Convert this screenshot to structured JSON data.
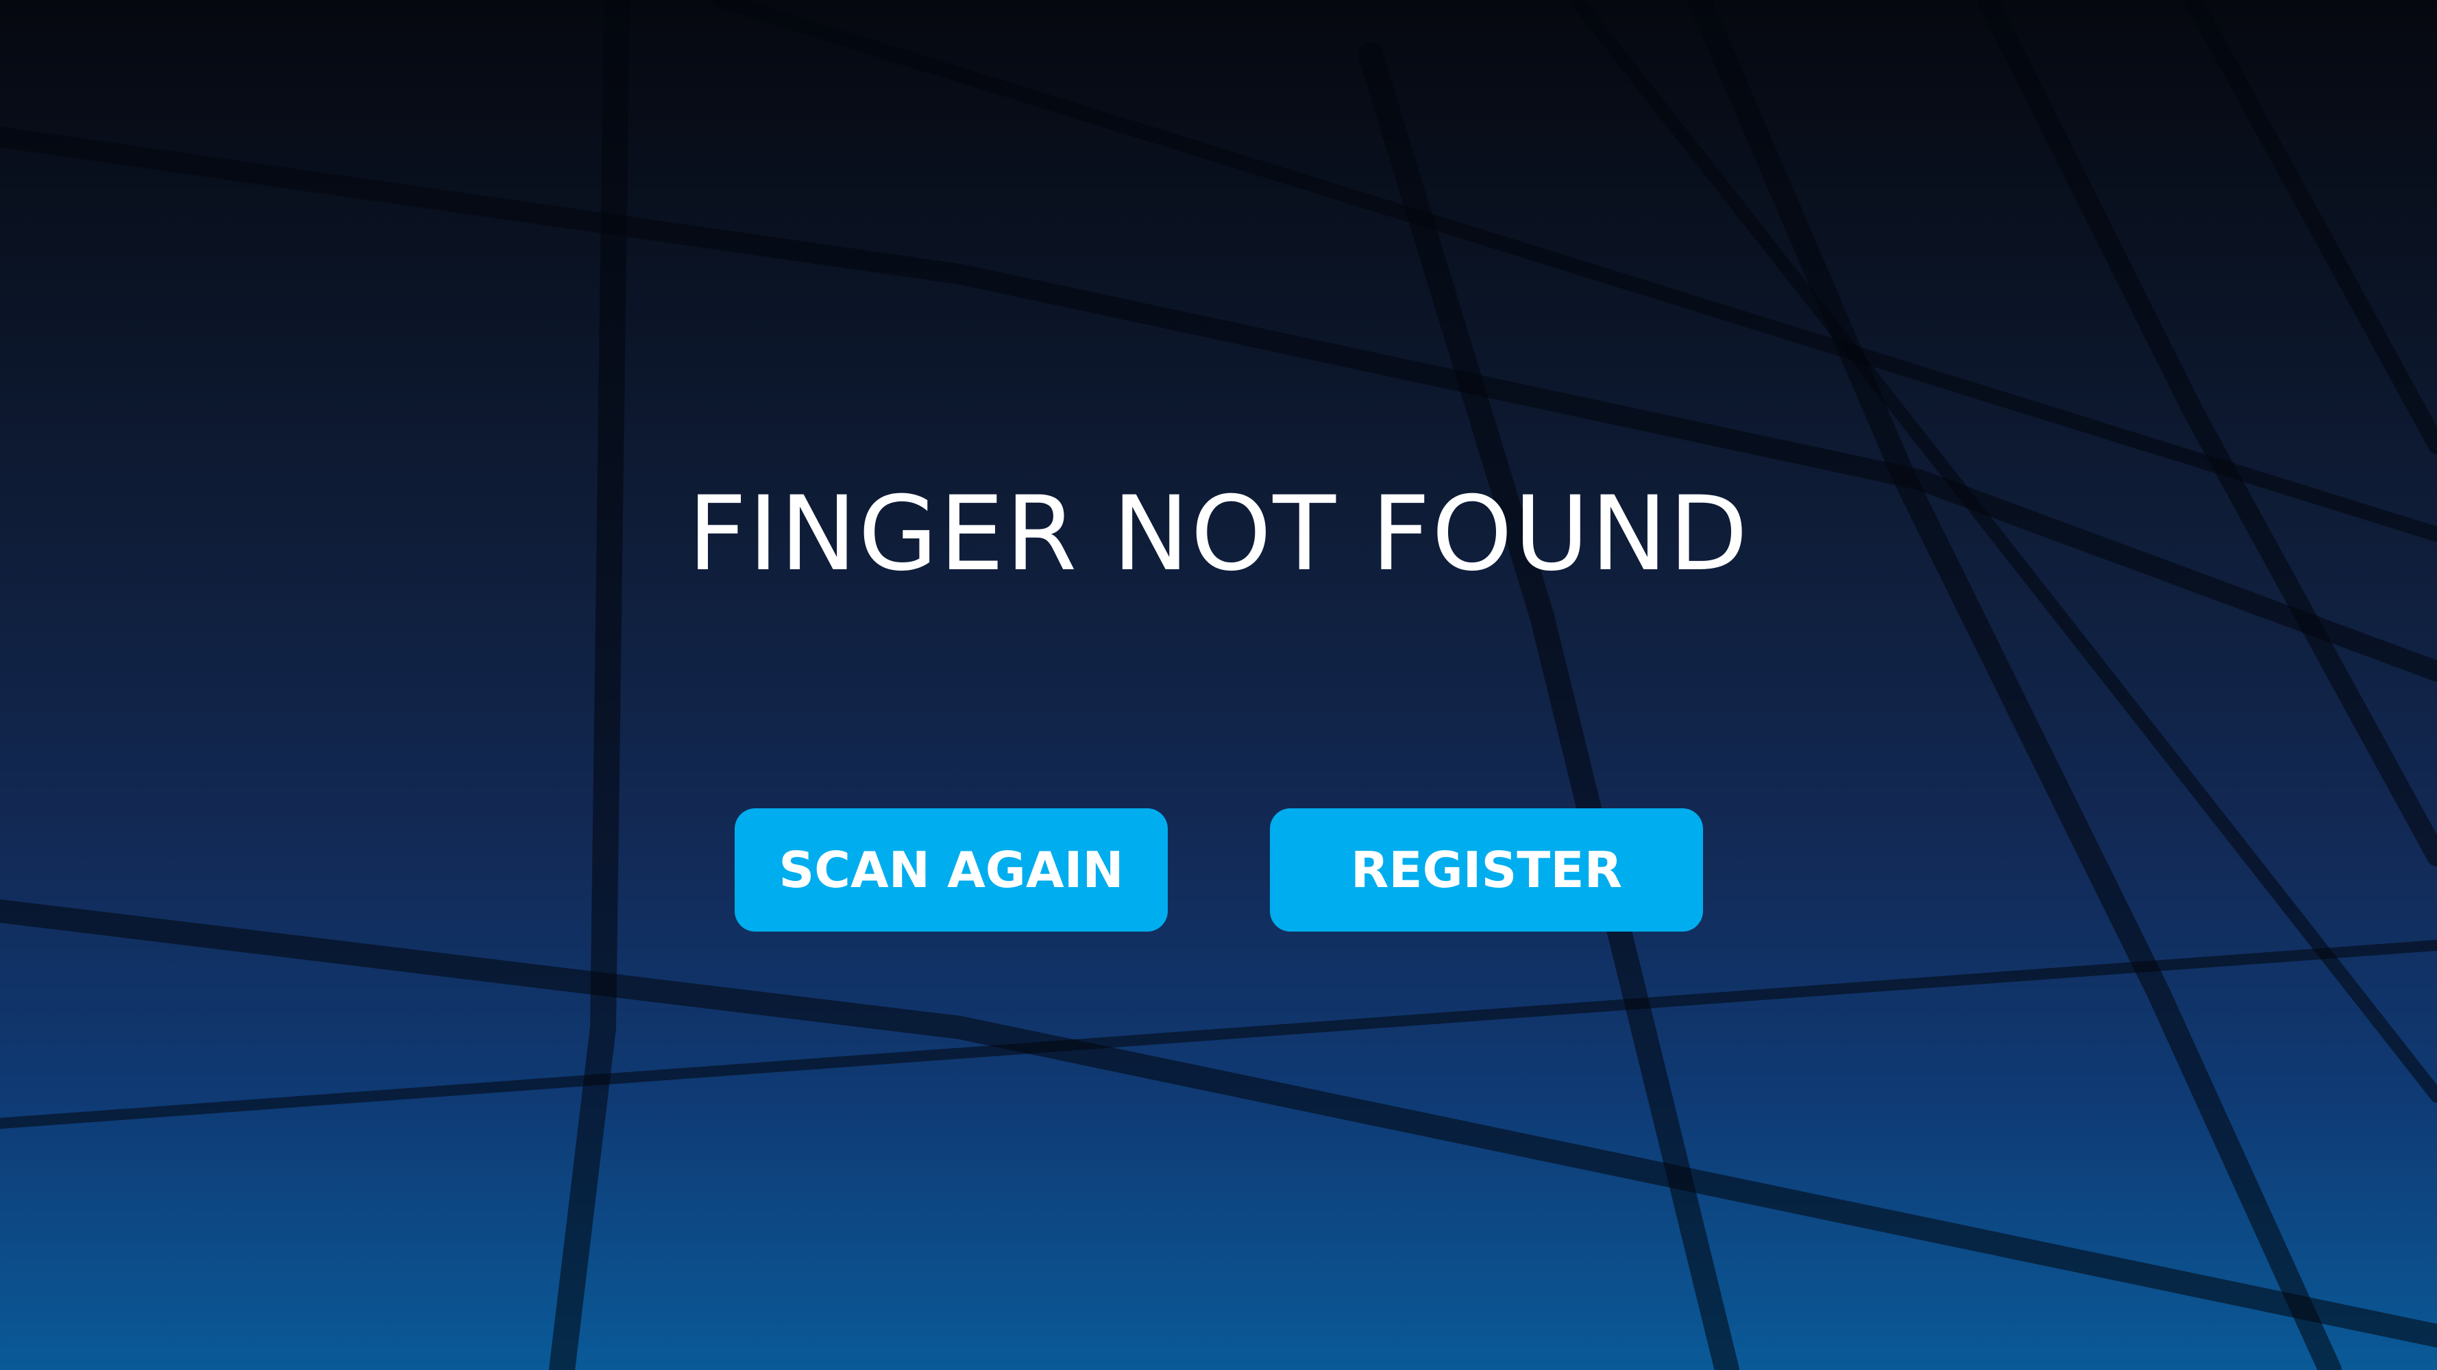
{
  "screen": {
    "title": "FINGER NOT FOUND"
  },
  "actions": {
    "scan_again_label": "SCAN AGAIN",
    "register_label": "REGISTER"
  },
  "colors": {
    "button_bg": "#00adee",
    "text": "#ffffff",
    "background_top": "#05080f",
    "background_bottom": "#0a5a98"
  }
}
